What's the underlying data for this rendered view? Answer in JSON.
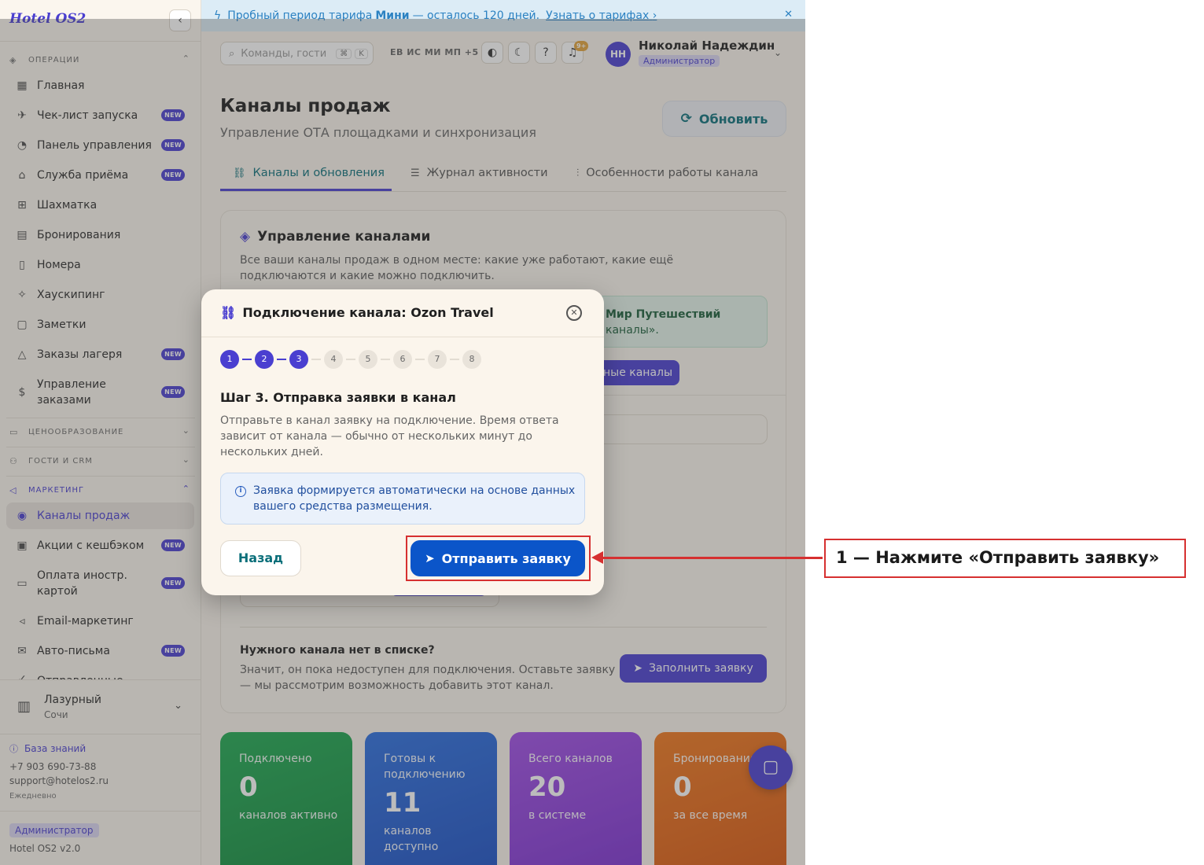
{
  "app": {
    "logo": "Hotel OS2",
    "collapse_icon": "‹"
  },
  "sidebar": {
    "sections": {
      "operations": "ОПЕРАЦИИ",
      "pricing": "ЦЕНООБРАЗОВАНИЕ",
      "guests": "ГОСТИ И CRM",
      "marketing": "МАРКЕТИНГ"
    },
    "badge_new": "NEW",
    "items": [
      {
        "label": "Главная",
        "icon": "grid-icon"
      },
      {
        "label": "Чек-лист запуска",
        "icon": "rocket-icon",
        "badge": "NEW"
      },
      {
        "label": "Панель управления",
        "icon": "gauge-icon",
        "badge": "NEW"
      },
      {
        "label": "Служба приёма",
        "icon": "bell-icon",
        "badge": "NEW"
      },
      {
        "label": "Шахматка",
        "icon": "table-icon"
      },
      {
        "label": "Бронирования",
        "icon": "clipboard-icon"
      },
      {
        "label": "Номера",
        "icon": "door-icon"
      },
      {
        "label": "Хаускипинг",
        "icon": "sparkle-icon"
      },
      {
        "label": "Заметки",
        "icon": "note-icon"
      },
      {
        "label": "Заказы лагеря",
        "icon": "tent-icon",
        "badge": "NEW"
      },
      {
        "label": "Управление заказами",
        "icon": "dollar-icon",
        "badge": "NEW"
      },
      {
        "label": "Каналы продаж",
        "icon": "broadcast-icon",
        "active": true
      },
      {
        "label": "Акции с кешбэком",
        "icon": "gift-icon",
        "badge": "NEW"
      },
      {
        "label": "Оплата иностр. картой",
        "icon": "card-icon",
        "badge": "NEW"
      },
      {
        "label": "Email-маркетинг",
        "icon": "send-icon"
      },
      {
        "label": "Авто-письма",
        "icon": "mail-icon",
        "badge": "NEW"
      },
      {
        "label": "Отправленные",
        "icon": "sent-icon"
      }
    ],
    "hotel": {
      "name": "Лазурный",
      "city": "Сочи"
    },
    "knowledge_base": "База знаний",
    "phone": "+7 903 690-73-88",
    "email": "support@hotelos2.ru",
    "schedule": "Ежедневно",
    "role": "Администратор",
    "version": "Hotel OS2 v2.0"
  },
  "banner": {
    "prefix": "Пробный период тарифа",
    "plan": "Мини",
    "suffix": "— осталось 120 дней.",
    "link": "Узнать о тарифах",
    "link_chevron": "›",
    "close_icon": "✕"
  },
  "topbar": {
    "search_placeholder": "Команды, гости",
    "kbd_mod": "⌘",
    "kbd_key": "K",
    "avatars_text": "ЕВ ИС МИ МП +5",
    "notif_count": "9+",
    "user_initials": "НН",
    "user_name": "Николай Надеждин",
    "user_role": "Администратор"
  },
  "page": {
    "title": "Каналы продаж",
    "subtitle": "Управление ОТА площадками и синхронизация",
    "refresh_label": "Обновить"
  },
  "tabs": [
    {
      "label": "Каналы и обновления",
      "icon": "link-icon",
      "active": true
    },
    {
      "label": "Журнал активности",
      "icon": "list-check-icon"
    },
    {
      "label": "Особенности работы канала",
      "icon": "sliders-icon"
    }
  ],
  "card": {
    "title": "Управление каналами",
    "description": "Все ваши каналы продаж в одном месте: какие уже работают, какие ещё подключаются и какие можно подключить.",
    "info_line1": "Мир Путешествий",
    "info_line2": "каналы».",
    "pill_text": "ные каналы",
    "need_title": "Нужного канала нет в списке?",
    "need_desc": "Значит, он пока недоступен для подключения. Оставьте заявку — мы рассмотрим возможность добавить этот канал.",
    "fill_label": "Заполнить заявку"
  },
  "stats": [
    {
      "label": "Подключено",
      "value": "0",
      "note": "каналов активно"
    },
    {
      "label": "Готовы к подключению",
      "value": "11",
      "note": "каналов доступно"
    },
    {
      "label": "Всего каналов",
      "value": "20",
      "note": "в системе"
    },
    {
      "label": "Бронирования",
      "value": "0",
      "note": "за все время"
    }
  ],
  "modal": {
    "title": "Подключение канала: Ozon Travel",
    "steps": [
      "1",
      "2",
      "3",
      "4",
      "5",
      "6",
      "7",
      "8"
    ],
    "current_step": 3,
    "step_heading": "Шаг 3. Отправка заявки в канал",
    "step_desc": "Отправьте в канал заявку на подключение. Время ответа зависит от канала — обычно от нескольких минут до нескольких дней.",
    "info_icon": "i",
    "info_text": "Заявка формируется автоматически на основе данных вашего средства размещения.",
    "back_label": "Назад",
    "submit_label": "Отправить заявку"
  },
  "annotation": {
    "callout": "1 — Нажмите «Отправить заявку»"
  },
  "colors": {
    "accent": "#4a3fd0",
    "submit": "#0b55c9",
    "highlight": "#d63030"
  }
}
